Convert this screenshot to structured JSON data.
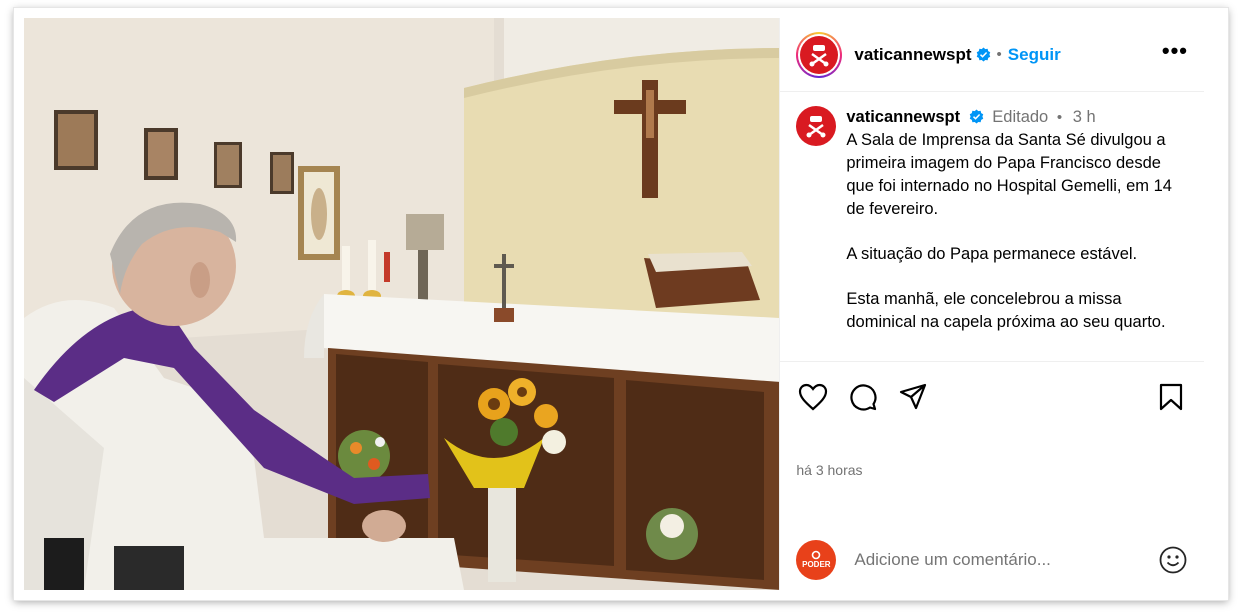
{
  "header": {
    "username": "vaticannewspt",
    "follow_label": "Seguir",
    "separator": "•",
    "more_label": "•••"
  },
  "caption": {
    "username": "vaticannewspt",
    "edited_label": "Editado",
    "separator": "•",
    "age": "3 h",
    "paragraphs": [
      "A Sala de Imprensa da Santa Sé divulgou a primeira imagem do Papa Francisco desde que foi internado no Hospital Gemelli, em 14 de fevereiro.",
      "A situação do Papa permanece estável.",
      "Esta manhã, ele concelebrou a missa dominical na capela próxima ao seu quarto."
    ]
  },
  "actions": {
    "like_icon": "heart-icon",
    "comment_icon": "comment-bubble-icon",
    "share_icon": "paper-plane-icon",
    "save_icon": "bookmark-icon"
  },
  "time_label": "há 3 horas",
  "comment": {
    "avatar_text": "PODER",
    "placeholder": "Adicione um comentário...",
    "emoji_icon": "smiley-icon"
  },
  "colors": {
    "follow": "#0095f6",
    "vatican_red": "#d91a21",
    "poder_orange": "#e8411a",
    "verified_blue": "#0095f6",
    "purple_stole": "#5b2d86"
  }
}
